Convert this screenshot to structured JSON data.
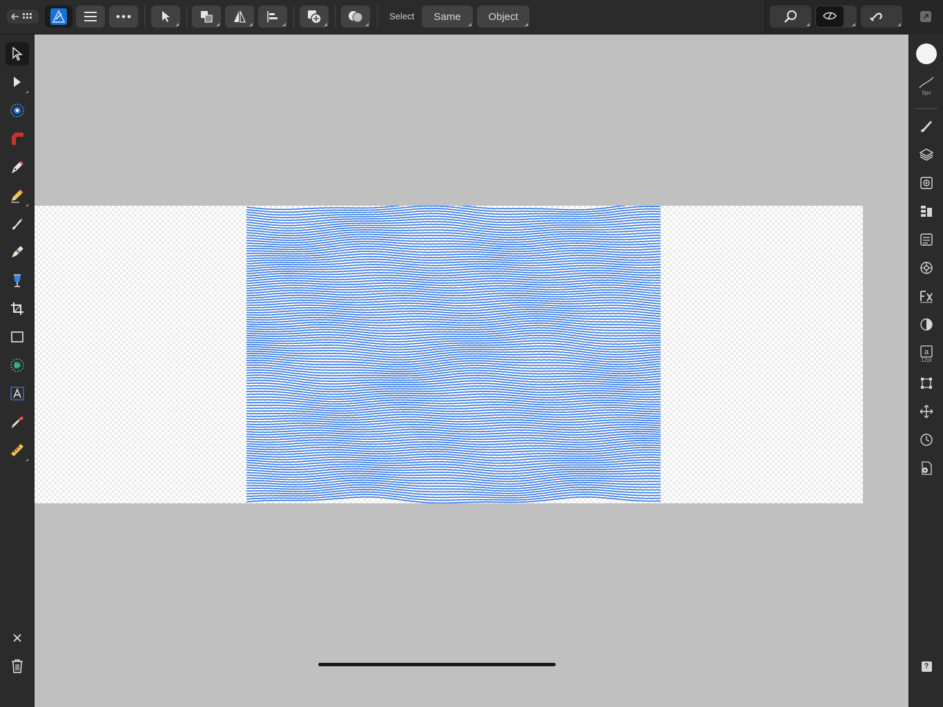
{
  "toolbar": {
    "select_label": "Select",
    "same_label": "Same",
    "object_label": "Object"
  },
  "right_panel": {
    "stroke_width": "0px",
    "font_size": "12pt",
    "help_glyph": "?"
  },
  "left_tools": [
    "move-tool-icon",
    "node-tool-icon",
    "contour-tool-icon",
    "corner-tool-icon",
    "pen-tool-icon",
    "pencil-tool-icon",
    "vector-brush-tool-icon",
    "fill-tool-icon",
    "transparency-tool-icon",
    "crop-tool-icon",
    "rectangle-tool-icon",
    "shape-tool-icon",
    "text-tool-icon",
    "color-picker-tool-icon",
    "measure-tool-icon"
  ],
  "right_tools": [
    "color-swatch-icon",
    "stroke-icon",
    "brushes-icon",
    "layers-icon",
    "appearance-icon",
    "text-styles-icon",
    "stock-icon",
    "navigator-icon",
    "fx-icon",
    "adjustments-icon",
    "character-icon",
    "transform-icon",
    "snapping-icon",
    "history-icon",
    "document-icon",
    "help-icon"
  ],
  "colors": {
    "accent": "#3a7fe8",
    "wave_stroke": "#2a74e6",
    "toolbar_bg": "#2b2b2b",
    "canvas_bg": "#c0c0c0"
  }
}
